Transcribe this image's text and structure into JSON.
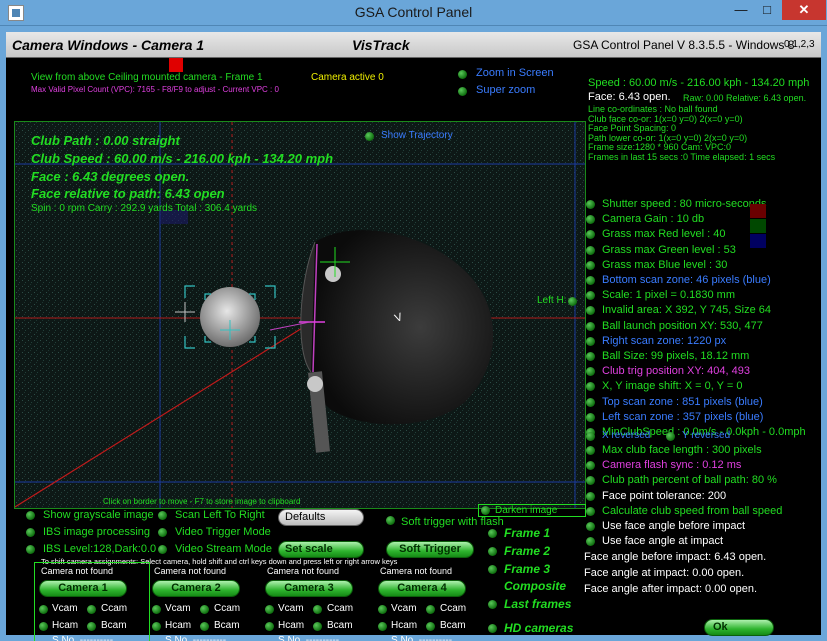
{
  "window": {
    "title": "GSA Control Panel",
    "min": "—",
    "max": "□",
    "close": "✕"
  },
  "header": {
    "camera_windows": "Camera Windows - Camera  1",
    "vistrack": "VisTrack",
    "version": "GSA Control Panel V 8.3.5.5 - Windows 8",
    "cams": "0,1,2,3"
  },
  "view": {
    "line1": "View from above Ceiling mounted camera - Frame 1",
    "camera_active": "Camera active 0",
    "line2": "Max Valid Pixel Count (VPC): 7165 - F8/F9 to adjust - Current VPC : 0",
    "zoom_in_screen": "Zoom in Screen",
    "super_zoom": "Super zoom",
    "show_trajectory": "Show Trajectory",
    "club_path": "Club Path : 0.00 straight",
    "club_speed": "Club Speed : 60.00 m/s - 216.00 kph - 134.20 mph",
    "face": "Face : 6.43 degrees open.",
    "face_rel": "Face relative to path: 6.43 open",
    "spin": "Spin : 0 rpm   Carry : 292.9 yards  Total : 306.4 yards",
    "bottom_hint": "Click on border to move - F7 to store image to clipboard",
    "club_logo": "V"
  },
  "right": {
    "speed": "Speed : 60.00 m/s - 216.00 kph - 134.20 mph",
    "face_open": "Face: 6.43 open.",
    "raw": "Raw: 0.00 Relative: 6.43 open.",
    "info": [
      "Line co-ordinates : No ball found",
      "Club face co-or: 1(x=0 y=0) 2(x=0 y=0)",
      "Face Point Spacing: 0",
      "Path lower co-or: 1(x=0 y=0) 2(x=0 y=0)",
      "Frame size:1280 * 960 Cam:  VPC:0",
      "Frames in last 15 secs :0 Time elapsed:   1 secs"
    ],
    "left_h": "Left H:",
    "settings": [
      {
        "text": "Shutter speed : 80 micro-seconds",
        "color": "#22dd22"
      },
      {
        "text": "Camera Gain : 10 db",
        "color": "#22dd22"
      },
      {
        "text": "Grass max Red level : 40",
        "color": "#22dd22"
      },
      {
        "text": "Grass max Green level : 53",
        "color": "#22dd22"
      },
      {
        "text": "Grass max Blue level : 30",
        "color": "#22dd22"
      },
      {
        "text": "Bottom scan zone: 46 pixels (blue)",
        "color": "#3a7cff"
      },
      {
        "text": "Scale: 1 pixel = 0.1830 mm",
        "color": "#22dd22"
      },
      {
        "text": "Invalid area: X 392, Y 745, Size 64",
        "color": "#22dd22"
      },
      {
        "text": "Ball launch position XY: 530, 477",
        "color": "#22dd22"
      },
      {
        "text": "Right scan zone: 1220 px",
        "color": "#3a7cff"
      },
      {
        "text": "Ball Size: 99 pixels, 18.12 mm",
        "color": "#22dd22"
      },
      {
        "text": "Club trig position XY: 404, 493",
        "color": "#e040e0"
      },
      {
        "text": "X, Y image shift: X = 0, Y = 0",
        "color": "#22dd22"
      },
      {
        "text": "Top scan zone : 851 pixels (blue)",
        "color": "#3a7cff"
      },
      {
        "text": "Left scan zone : 357 pixels (blue)",
        "color": "#3a7cff"
      },
      {
        "text": "MinClubSpeed : 0.0m/s - 0.0kph - 0.0mph",
        "color": "#22dd22"
      }
    ],
    "x_reversed": "X reversed",
    "y_reversed": "Y reversed",
    "settings2": [
      {
        "text": "Max club face length : 300 pixels",
        "color": "#22dd22"
      },
      {
        "text": "Camera flash sync :  0.12 ms",
        "color": "#e040e0"
      },
      {
        "text": "Club path percent of ball path: 80 %",
        "color": "#22dd22"
      },
      {
        "text": "Face point tolerance: 200",
        "color": "#ffffff"
      },
      {
        "text": "Calculate club speed from ball speed",
        "color": "#22dd22"
      },
      {
        "text": "Use face angle before impact",
        "color": "#ffffff"
      },
      {
        "text": "Use face angle at impact",
        "color": "#ffffff"
      }
    ],
    "face_before": "Face angle before impact: 6.43 open.",
    "face_at": "Face angle at impact:        0.00 open.",
    "face_after": "Face angle after impact:   0.00 open.",
    "ok": "Ok",
    "grass_colors": {
      "red": "#6a0000",
      "green": "#004800",
      "blue": "#000060"
    }
  },
  "controls": {
    "show_grayscale": "Show grayscale image",
    "scan_left_right": "Scan Left To Right",
    "defaults": "Defaults",
    "soft_trigger_flash": "Soft trigger with flash",
    "darken_image": "Darken image",
    "ibs_processing": "IBS image processing",
    "video_trigger": "Video Trigger Mode",
    "ibs_level": "IBS Level:128,Dark:0.0",
    "video_stream": "Video Stream Mode",
    "set_scale": "Set scale",
    "soft_trigger": "Soft Trigger",
    "shift_hint": "To shift camera assignments: Select camera, hold shift and ctrl keys down and press left or right arrow keys"
  },
  "frames": [
    "Frame 1",
    "Frame 2",
    "Frame 3",
    "Composite",
    "Last frames",
    "HD cameras"
  ],
  "cameras": [
    {
      "status": "Camera not found",
      "label": "Camera 1",
      "vcam": "Vcam",
      "ccam": "Ccam",
      "hcam": "Hcam",
      "bcam": "Bcam",
      "sno": "S.No. ----------"
    },
    {
      "status": "Camera not found",
      "label": "Camera 2",
      "vcam": "Vcam",
      "ccam": "Ccam",
      "hcam": "Hcam",
      "bcam": "Bcam",
      "sno": "S.No. ----------"
    },
    {
      "status": "Camera not found",
      "label": "Camera 3",
      "vcam": "Vcam",
      "ccam": "Ccam",
      "hcam": "Hcam",
      "bcam": "Bcam",
      "sno": "S.No. ----------"
    },
    {
      "status": "Camera not found",
      "label": "Camera 4",
      "vcam": "Vcam",
      "ccam": "Ccam",
      "hcam": "Hcam",
      "bcam": "Bcam",
      "sno": "S.No. ----------"
    }
  ]
}
